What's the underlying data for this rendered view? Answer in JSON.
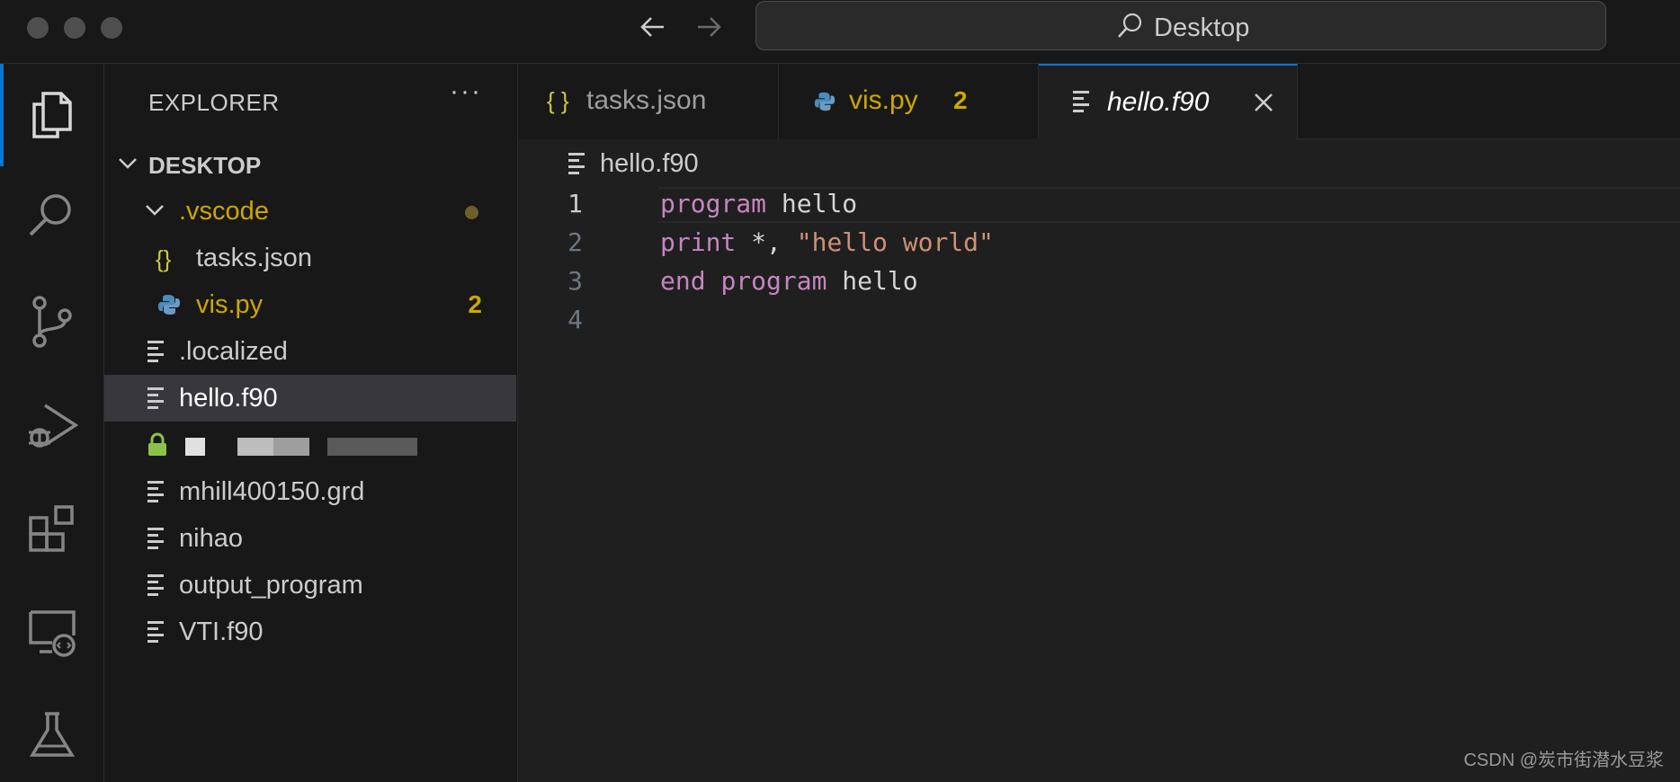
{
  "titlebar": {
    "search_label": "Desktop"
  },
  "activity_bar": {
    "items": [
      {
        "icon": "files-icon",
        "active": true
      },
      {
        "icon": "search-icon"
      },
      {
        "icon": "source-control-icon"
      },
      {
        "icon": "run-debug-icon"
      },
      {
        "icon": "extensions-icon"
      },
      {
        "icon": "remote-explorer-icon"
      },
      {
        "icon": "testing-icon"
      }
    ]
  },
  "sidebar": {
    "title": "EXPLORER",
    "more": "···",
    "folder": "DESKTOP",
    "items": [
      {
        "label": ".vscode",
        "type": "folder"
      },
      {
        "label": "tasks.json",
        "type": "json"
      },
      {
        "label": "vis.py",
        "type": "python",
        "badge": "2"
      },
      {
        "label": ".localized",
        "type": "text"
      },
      {
        "label": "hello.f90",
        "type": "text",
        "selected": true
      },
      {
        "label": "",
        "type": "locked-blurred"
      },
      {
        "label": "mhill400150.grd",
        "type": "text"
      },
      {
        "label": "nihao",
        "type": "text"
      },
      {
        "label": "output_program",
        "type": "text"
      },
      {
        "label": "VTI.f90",
        "type": "text"
      }
    ]
  },
  "tabs": [
    {
      "label": "tasks.json",
      "icon": "{ }"
    },
    {
      "label": "vis.py",
      "badge": "2"
    },
    {
      "label": "hello.f90",
      "active": true
    }
  ],
  "breadcrumb": "hello.f90",
  "editor": {
    "line_numbers": [
      "1",
      "2",
      "3",
      "4"
    ],
    "lines": [
      {
        "kw1": "program",
        "rest": " hello"
      },
      {
        "kw1": "print",
        "mid": " *, ",
        "str": "\"hello world\""
      },
      {
        "kw1": "end",
        "sp": " ",
        "kw2": "program",
        "rest": " hello"
      },
      {}
    ]
  },
  "watermark": "CSDN @炭市街潜水豆浆",
  "colors": {
    "accent": "#0078d4",
    "keyword": "#c586c0",
    "string": "#ce9178",
    "folder_text": "#cca700",
    "badge": "#cca700"
  }
}
